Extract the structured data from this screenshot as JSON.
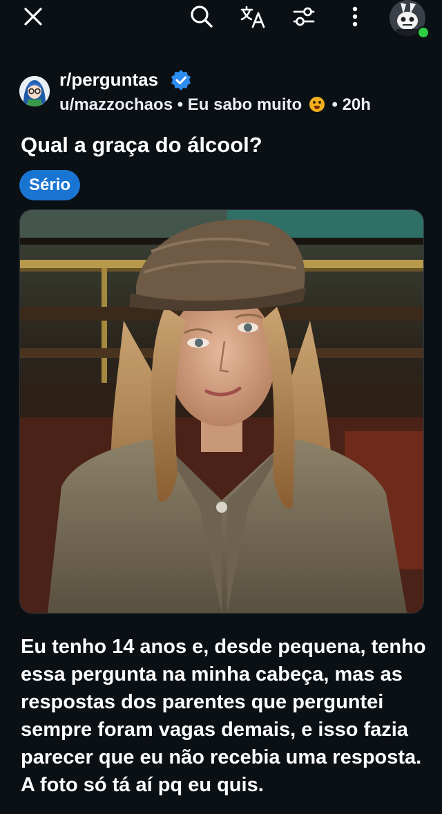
{
  "topbar": {
    "close_icon": "close-icon",
    "search_icon": "search-icon",
    "translate_icon": "translate-icon",
    "filter_icon": "sort-filter-icon",
    "more_icon": "more-vertical-icon",
    "avatar_icon": "user-avatar",
    "online_color": "#2ecc40"
  },
  "post": {
    "subreddit": "r/perguntas",
    "verified_icon": "verified-badge-icon",
    "author": "u/mazzochaos",
    "author_flair": "Eu sabo muito",
    "author_flair_emoji": "astonished-face-emoji",
    "sep1": "•",
    "sep2": "•",
    "age": "20h",
    "title": "Qual a graça do álcool?",
    "flair": "Sério",
    "flair_color": "#1a75d2",
    "image": "post-image-woman-in-cap",
    "body": "Eu tenho 14 anos e, desde pequena, tenho essa pergunta na minha cabeça, mas as respostas dos parentes que perguntei sempre foram vagas demais, e isso fazia parecer que eu não recebia uma resposta. A foto só tá aí pq eu quis."
  }
}
